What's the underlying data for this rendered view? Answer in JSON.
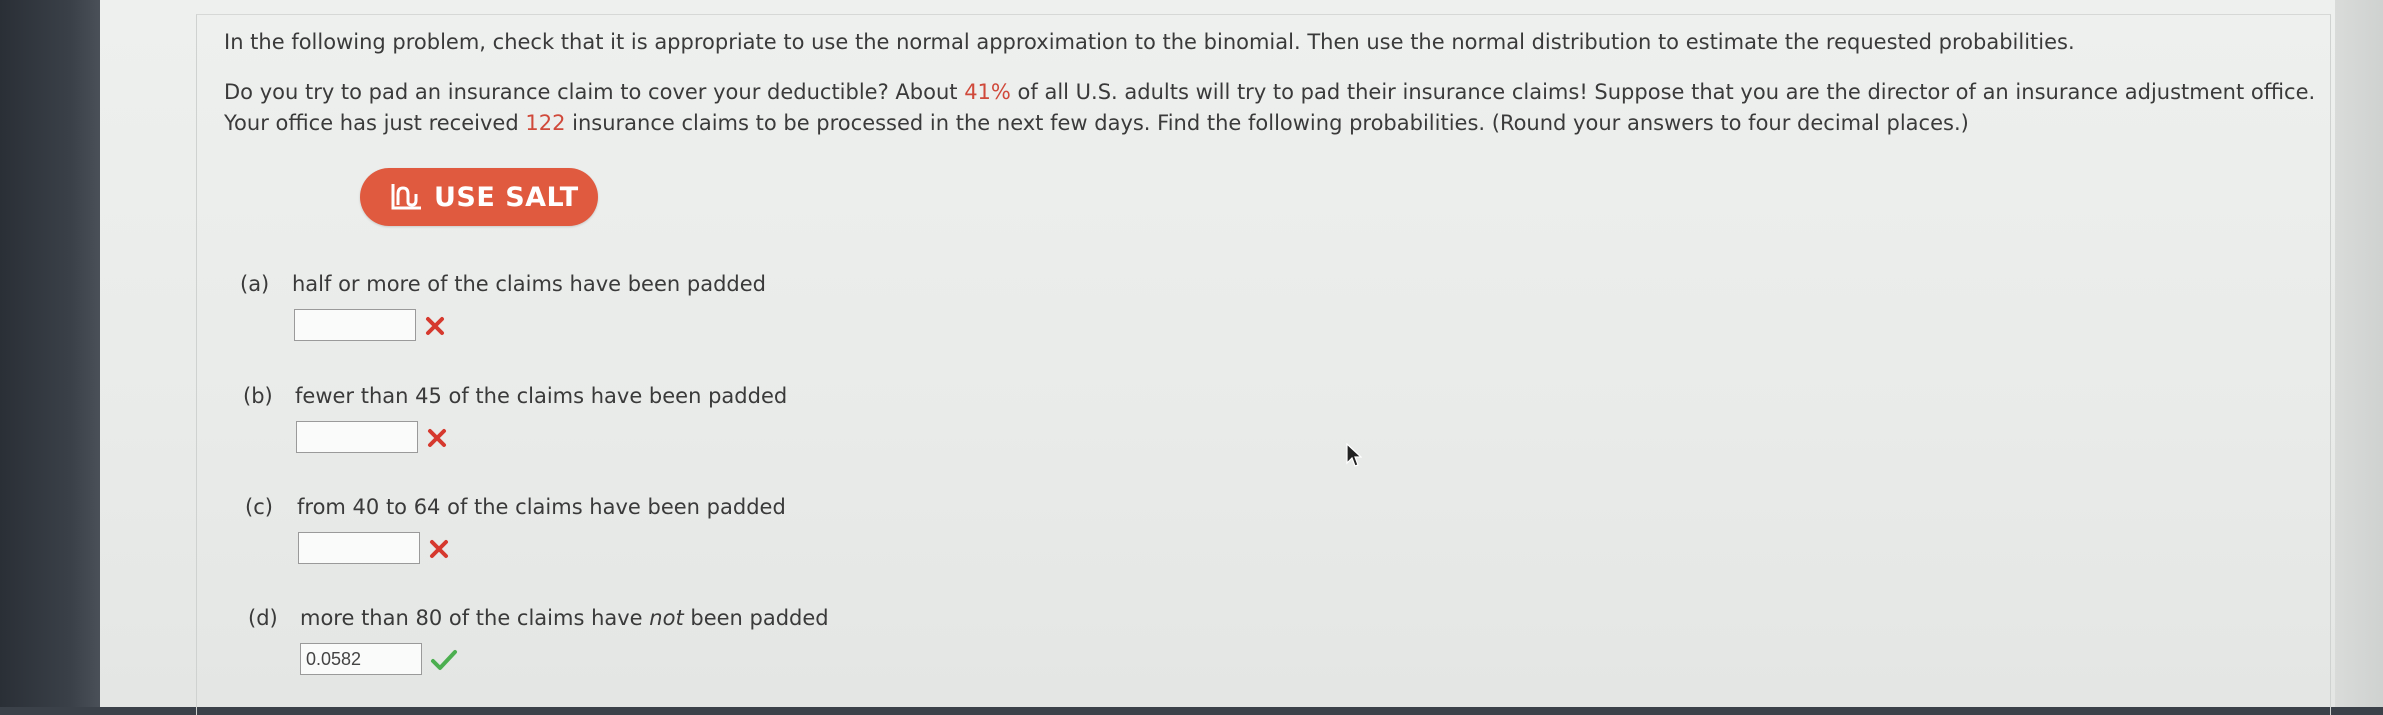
{
  "problem": {
    "instruction": "In the following problem, check that it is appropriate to use the normal approximation to the binomial. Then use the normal distribution to estimate the requested probabilities.",
    "line1_a": "Do you try to pad an insurance claim to cover your deductible? About ",
    "line1_pct": "41%",
    "line1_b": " of all U.S. adults will try to pad their insurance claims! Suppose that you are the director of an insurance adjustment office.",
    "line2_a": "Your office has just received ",
    "line2_n": "122",
    "line2_b": " insurance claims to be processed in the next few days. Find the following probabilities. (Round your answers to four decimal places.)"
  },
  "salt_button": {
    "label": "USE SALT",
    "icon": "salt-chart-icon",
    "color": "#e05a3f"
  },
  "parts": {
    "a": {
      "letter": "(a)",
      "text": "half or more of the claims have been padded",
      "value": "",
      "status": "incorrect"
    },
    "b": {
      "letter": "(b)",
      "text": "fewer than 45 of the claims have been padded",
      "value": "",
      "status": "incorrect"
    },
    "c": {
      "letter": "(c)",
      "text": "from 40 to 64 of the claims have been padded",
      "value": "",
      "status": "incorrect"
    },
    "d": {
      "letter": "(d)",
      "text_a": "more than 80 of the claims have ",
      "text_em": "not",
      "text_b": " been padded",
      "value": "0.0582",
      "status": "correct"
    }
  },
  "colors": {
    "incorrect": "#d6392e",
    "correct": "#4caf50",
    "accent": "#d0493a"
  }
}
